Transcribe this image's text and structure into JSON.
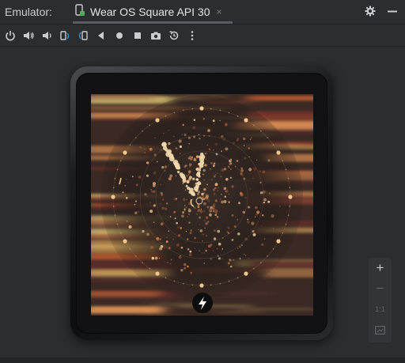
{
  "panel": {
    "title": "Emulator:"
  },
  "tab": {
    "label": "Wear OS Square API 30",
    "close_glyph": "×"
  },
  "header_actions": [
    {
      "name": "settings-gear-icon"
    },
    {
      "name": "minimize-icon"
    }
  ],
  "toolbar": [
    {
      "name": "power-icon"
    },
    {
      "name": "volume-up-icon"
    },
    {
      "name": "volume-down-icon"
    },
    {
      "name": "rotate-left-icon"
    },
    {
      "name": "rotate-right-icon"
    },
    {
      "name": "back-icon"
    },
    {
      "name": "home-icon"
    },
    {
      "name": "overview-icon"
    },
    {
      "name": "screenshot-camera-icon"
    },
    {
      "name": "snapshot-icon"
    },
    {
      "name": "more-options-icon"
    }
  ],
  "zoom_controls": {
    "zoom_in": "+",
    "zoom_out": "−",
    "actual_size": "1:1"
  },
  "watch_face": {
    "complication_icon": "bolt-icon"
  },
  "colors": {
    "background": "#2b2d30",
    "accent": "#3592c4"
  }
}
